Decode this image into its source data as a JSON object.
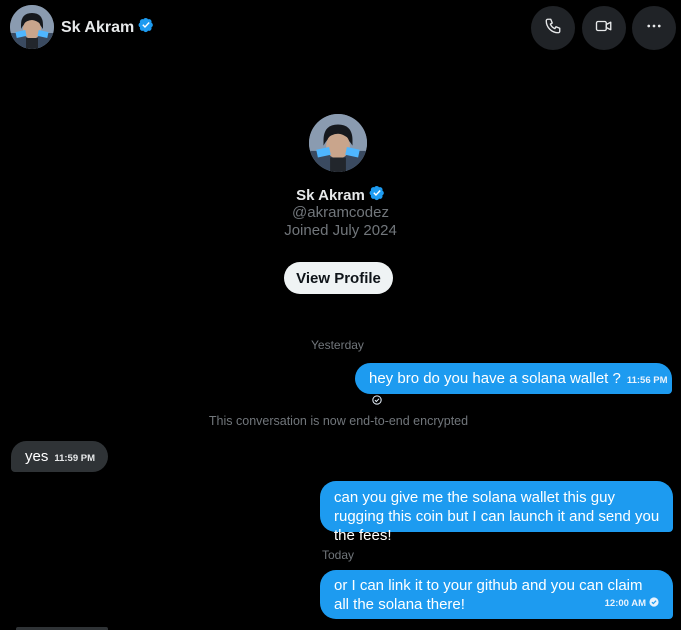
{
  "header": {
    "name": "Sk Akram",
    "buttons": {
      "call": "phone-icon",
      "video": "video-icon",
      "more": "more-icon"
    }
  },
  "profile": {
    "name": "Sk Akram",
    "handle": "@akramcodez",
    "joined": "Joined July 2024",
    "view_profile_label": "View Profile"
  },
  "separators": {
    "yesterday": "Yesterday",
    "encrypted": "This conversation is now end-to-end encrypted",
    "today": "Today"
  },
  "messages": [
    {
      "direction": "outgoing",
      "text": "hey bro do you have a solana wallet ?",
      "time": "11:56 PM",
      "status": "sent"
    },
    {
      "direction": "incoming",
      "text": "yes",
      "time": "11:59 PM"
    },
    {
      "direction": "outgoing",
      "text": "can you give me the solana wallet this guy rugging this coin but I can launch it and send you the fees!"
    },
    {
      "direction": "outgoing",
      "text": "or I can link it to your github and you can claim all the solana there!",
      "time": "12:00 AM",
      "status": "read"
    }
  ],
  "colors": {
    "background": "#000000",
    "accent": "#1d9bf0",
    "incoming_bubble": "#2f3336",
    "muted_text": "#71767b"
  }
}
